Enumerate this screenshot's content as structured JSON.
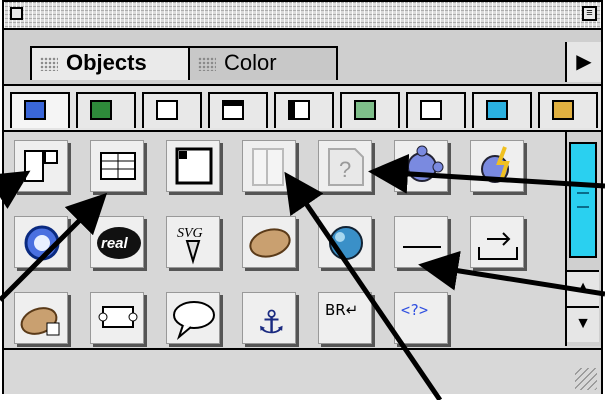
{
  "window": {
    "tabs": [
      {
        "label": "Objects",
        "active": true
      },
      {
        "label": "Color",
        "active": false
      }
    ],
    "menu_button_icon": "triangle-right-icon",
    "categories": [
      {
        "name": "characters-icon",
        "active": true
      },
      {
        "name": "common-icon",
        "active": false
      },
      {
        "name": "forms-icon",
        "active": false
      },
      {
        "name": "frames-icon",
        "active": false
      },
      {
        "name": "head-icon",
        "active": false
      },
      {
        "name": "invisibles-icon",
        "active": false
      },
      {
        "name": "script-icon",
        "active": false
      },
      {
        "name": "plugins-icon",
        "active": false
      },
      {
        "name": "more-icon",
        "active": false
      }
    ]
  },
  "objects": [
    {
      "row": 0,
      "icon": "layer-icon"
    },
    {
      "row": 0,
      "icon": "table-icon"
    },
    {
      "row": 0,
      "icon": "image-icon"
    },
    {
      "row": 0,
      "icon": "frame-icon"
    },
    {
      "row": 0,
      "icon": "unknown-plugin-icon",
      "text": "?"
    },
    {
      "row": 0,
      "icon": "puzzle-icon"
    },
    {
      "row": 0,
      "icon": "shockwave-puzzle-icon"
    },
    {
      "row": 1,
      "icon": "quicktime-icon"
    },
    {
      "row": 1,
      "icon": "real-icon",
      "text": "real"
    },
    {
      "row": 1,
      "icon": "svg-icon",
      "text": "SVG"
    },
    {
      "row": 1,
      "icon": "bean-icon"
    },
    {
      "row": 1,
      "icon": "sphere-icon"
    },
    {
      "row": 1,
      "icon": "horizontal-rule-icon"
    },
    {
      "row": 1,
      "icon": "tray-icon"
    },
    {
      "row": 2,
      "icon": "applet-bean-icon"
    },
    {
      "row": 2,
      "icon": "scroll-icon"
    },
    {
      "row": 2,
      "icon": "comment-icon"
    },
    {
      "row": 2,
      "icon": "anchor-icon",
      "text": "⚓"
    },
    {
      "row": 2,
      "icon": "line-break-icon",
      "text": "BR↵"
    },
    {
      "row": 2,
      "icon": "tag-icon",
      "text": "<?>"
    }
  ],
  "colors": {
    "thumb": "#2ad0f0",
    "accent_blue": "#3a66d8",
    "palette_bg": "#d7d7d7"
  }
}
